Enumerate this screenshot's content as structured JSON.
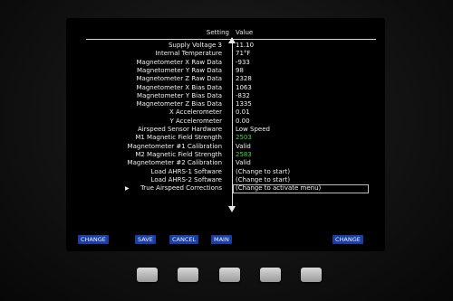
{
  "header": {
    "setting": "Setting",
    "value": "Value"
  },
  "rows": [
    {
      "label": "Supply Voltage 3",
      "value": "11.10",
      "color": "white"
    },
    {
      "label": "Internal Temperature",
      "value": "71°F",
      "color": "white"
    },
    {
      "label": "Magnetometer X Raw Data",
      "value": "-933",
      "color": "white"
    },
    {
      "label": "Magnetometer Y Raw Data",
      "value": "98",
      "color": "white"
    },
    {
      "label": "Magnetometer Z Raw Data",
      "value": "2328",
      "color": "white"
    },
    {
      "label": "Magnetometer X Bias Data",
      "value": "1063",
      "color": "white"
    },
    {
      "label": "Magnetometer Y Bias Data",
      "value": "-832",
      "color": "white"
    },
    {
      "label": "Magnetometer Z Bias Data",
      "value": "1335",
      "color": "white"
    },
    {
      "label": "X Accelerometer",
      "value": "0.01",
      "color": "white"
    },
    {
      "label": "Y Accelerometer",
      "value": "0.00",
      "color": "white"
    },
    {
      "label": "Airspeed Sensor Hardware",
      "value": "Low Speed",
      "color": "white"
    },
    {
      "label": "M1 Magnetic Field Strength",
      "value": "2503",
      "color": "green"
    },
    {
      "label": "Magnetometer #1 Calibration",
      "value": "Valid",
      "color": "white"
    },
    {
      "label": "M2 Magnetic Field Strength",
      "value": "2583",
      "color": "green"
    },
    {
      "label": "Magnetometer #2 Calibration",
      "value": "Valid",
      "color": "white"
    },
    {
      "label": "Load AHRS-1 Software",
      "value": "(Change to start)",
      "color": "white"
    },
    {
      "label": "Load AHRS-2 Software",
      "value": "(Change to start)",
      "color": "white"
    },
    {
      "label": "True Airspeed Corrections",
      "value": "(Change to activate menu)",
      "color": "white",
      "selected": true
    }
  ],
  "softkeys": {
    "change_left": "CHANGE",
    "save": "SAVE",
    "cancel": "CANCEL",
    "main": "MAIN",
    "change_right": "CHANGE"
  },
  "colors": {
    "softkey_bg": "#1b3da6",
    "value_green": "#3fdc3f",
    "text": "#f0f0f0"
  }
}
